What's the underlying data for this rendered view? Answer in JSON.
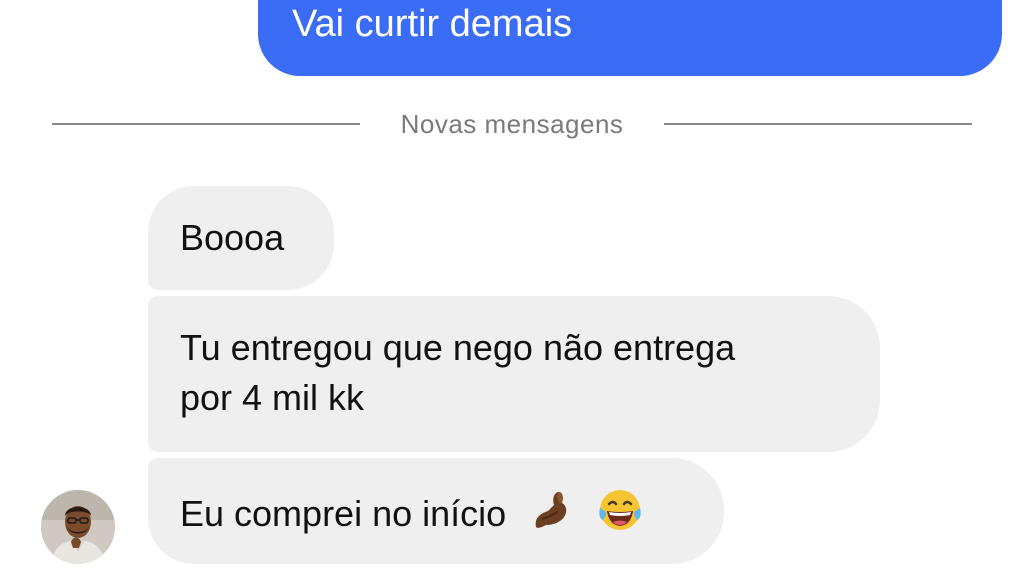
{
  "conversation": {
    "sent_messages": [
      {
        "text": "Vai curtir demais"
      }
    ],
    "divider": {
      "label": "Novas mensagens"
    },
    "received_messages": [
      {
        "text": "Boooa"
      },
      {
        "lines": [
          "Tu entregou que nego não entrega",
          "por 4 mil kk"
        ]
      },
      {
        "text": "Eu comprei no início",
        "emojis": [
          "pinched-fingers-icon",
          "laughing-tears-icon"
        ]
      }
    ]
  },
  "colors": {
    "sent_bubble": "#3b6cf6",
    "received_bubble": "#efefef",
    "divider_text": "#7a7a7a",
    "background": "#ffffff"
  }
}
